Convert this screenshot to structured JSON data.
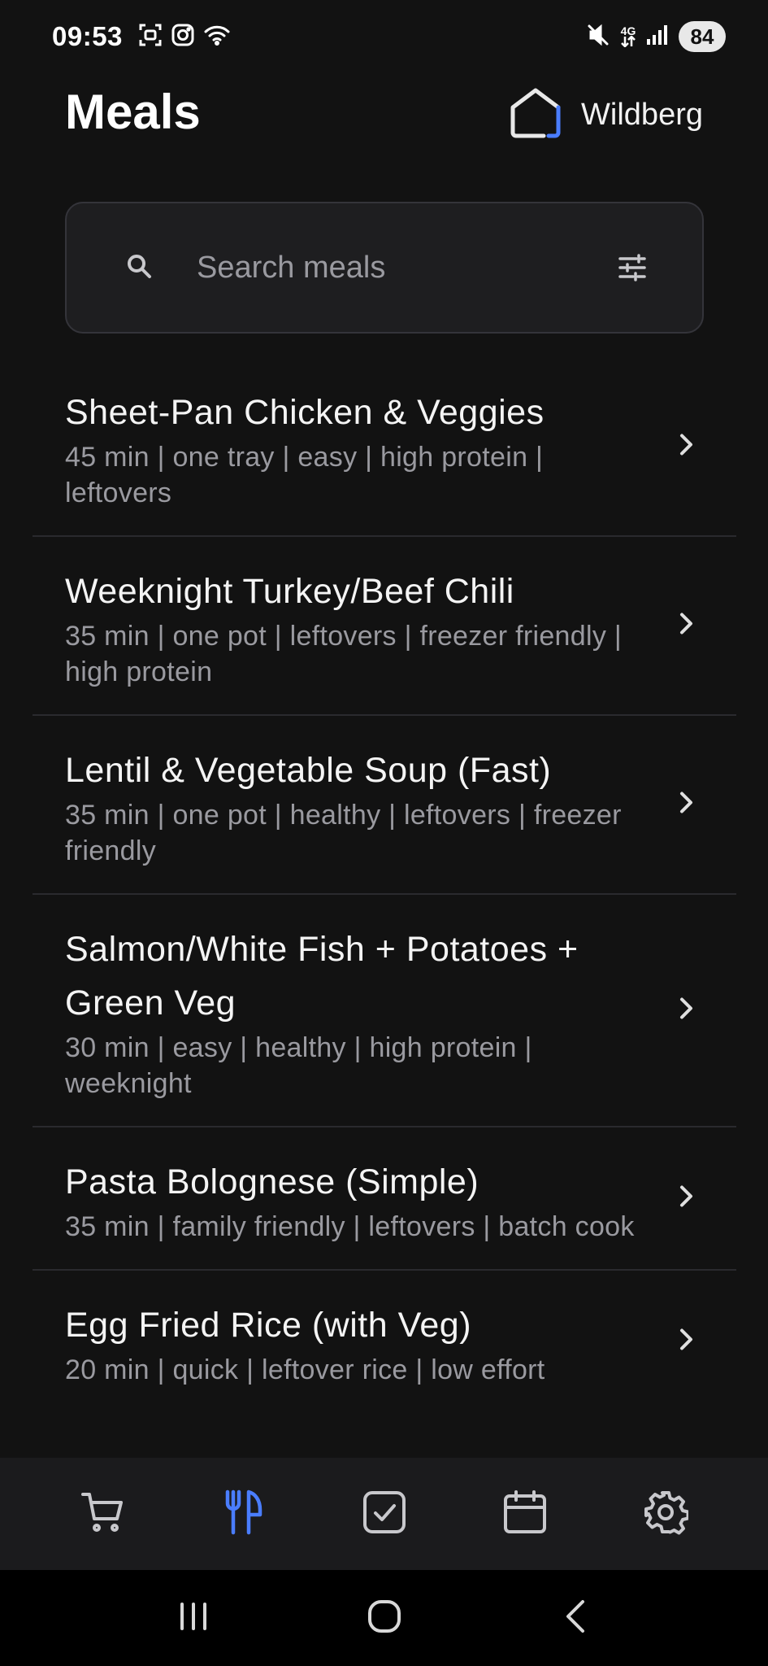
{
  "status_bar": {
    "time": "09:53",
    "network": "4G",
    "battery": "84"
  },
  "header": {
    "title": "Meals",
    "brand_name": "Wildberg"
  },
  "search": {
    "placeholder": "Search meals",
    "value": ""
  },
  "meals": [
    {
      "title": "Sheet-Pan Chicken & Veggies",
      "tags": "45 min | one tray | easy | high protein | leftovers"
    },
    {
      "title": "Weeknight Turkey/Beef Chili",
      "tags": "35 min | one pot | leftovers | freezer friendly | high protein"
    },
    {
      "title": "Lentil & Vegetable Soup (Fast)",
      "tags": "35 min | one pot | healthy | leftovers | freezer friendly"
    },
    {
      "title": "Salmon/White Fish + Potatoes + Green Veg",
      "tags": "30 min | easy | healthy | high protein | weeknight"
    },
    {
      "title": "Pasta Bolognese (Simple)",
      "tags": "35 min | family friendly | leftovers | batch cook"
    },
    {
      "title": "Egg Fried Rice (with Veg)",
      "tags": "20 min | quick | leftover rice | low effort"
    }
  ],
  "bottom_nav": {
    "active": "meals",
    "items": [
      "cart-icon",
      "utensils-icon",
      "checkbox-icon",
      "calendar-icon",
      "gear-icon"
    ]
  },
  "colors": {
    "background": "#121212",
    "accent": "#4a7dff",
    "text_secondary": "#9a9aa0"
  }
}
